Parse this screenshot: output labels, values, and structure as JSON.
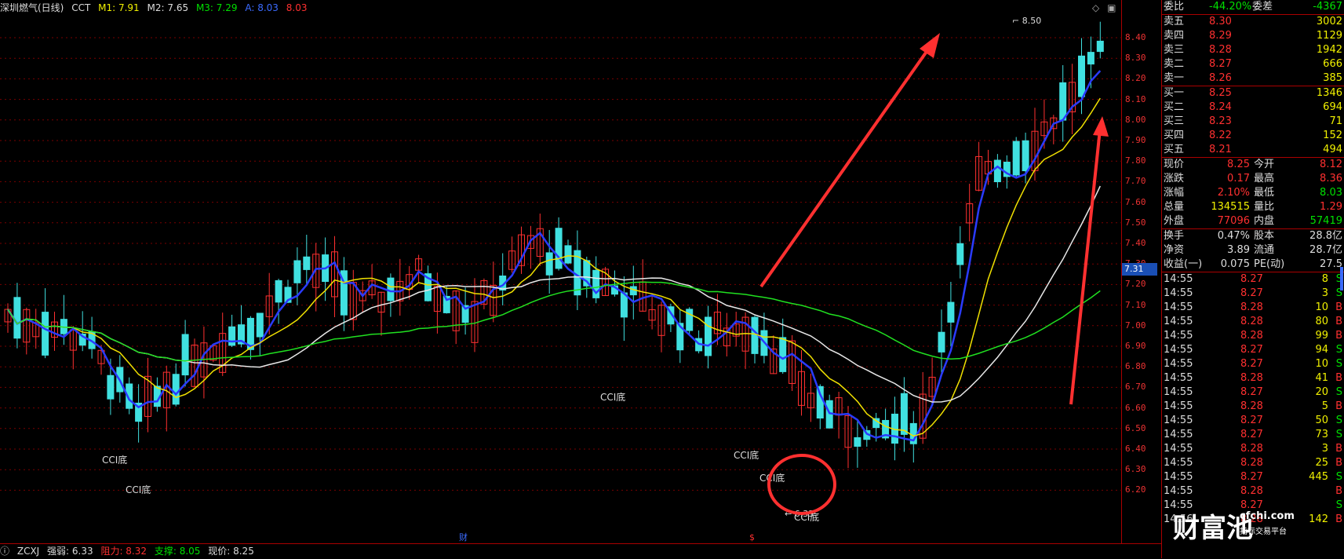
{
  "legend": {
    "stock": "深圳燃气(日线)",
    "indicator": "CCT",
    "m1": "M1: 7.91",
    "m2": "M2: 7.65",
    "m3": "M3: 7.29",
    "a": "A: 8.03",
    "b": "8.03"
  },
  "colors": {
    "up": "#ff3030",
    "down": "#40e0e0",
    "ma_blue": "#2a3bff",
    "ma_yellow": "#f0e000",
    "ma_white": "#e8e8e8",
    "ma_green": "#20e020",
    "axis": "#e33",
    "grid": "#7a0000"
  },
  "price_axis": [
    "8.40",
    "8.30",
    "8.20",
    "8.10",
    "8.00",
    "7.90",
    "7.80",
    "7.70",
    "7.60",
    "7.50",
    "7.40",
    "7.30",
    "7.20",
    "7.10",
    "7.00",
    "6.90",
    "6.80",
    "6.70",
    "6.60",
    "6.50",
    "6.40",
    "6.30",
    "6.20"
  ],
  "current_price_label": "7.31",
  "annotations": {
    "high": "8.50",
    "low": "6.33",
    "cci_labels": [
      "CCI底",
      "CCI底",
      "CCI底",
      "CCI底",
      "CCI底",
      "CCI底"
    ],
    "markers": [
      "财",
      "$"
    ]
  },
  "indicator_bar": {
    "name": "ZCXJ",
    "strength": "强弱: 6.33",
    "resistance": "阻力: 8.32",
    "support": "支撑: 8.05",
    "price": "现价: 8.25"
  },
  "panel": {
    "wei_bi_label": "委比",
    "wei_bi": "-44.20%",
    "wei_cha_label": "委差",
    "wei_cha": "-4367",
    "asks": [
      {
        "label": "卖五",
        "price": "8.30",
        "vol": "3002"
      },
      {
        "label": "卖四",
        "price": "8.29",
        "vol": "1129"
      },
      {
        "label": "卖三",
        "price": "8.28",
        "vol": "1942"
      },
      {
        "label": "卖二",
        "price": "8.27",
        "vol": "666"
      },
      {
        "label": "卖一",
        "price": "8.26",
        "vol": "385"
      }
    ],
    "bids": [
      {
        "label": "买一",
        "price": "8.25",
        "vol": "1346"
      },
      {
        "label": "买二",
        "price": "8.24",
        "vol": "694"
      },
      {
        "label": "买三",
        "price": "8.23",
        "vol": "71"
      },
      {
        "label": "买四",
        "price": "8.22",
        "vol": "152"
      },
      {
        "label": "买五",
        "price": "8.21",
        "vol": "494"
      }
    ],
    "stats": [
      {
        "l1": "现价",
        "v1": "8.25",
        "l2": "今开",
        "v2": "8.12"
      },
      {
        "l1": "涨跌",
        "v1": "0.17",
        "l2": "最高",
        "v2": "8.36"
      },
      {
        "l1": "涨幅",
        "v1": "2.10%",
        "l2": "最低",
        "v2": "8.03"
      },
      {
        "l1": "总量",
        "v1": "134515",
        "l2": "量比",
        "v2": "1.29"
      },
      {
        "l1": "外盘",
        "v1": "77096",
        "l2": "内盘",
        "v2": "57419"
      }
    ],
    "stats2": [
      {
        "l1": "换手",
        "v1": "0.47%",
        "l2": "股本",
        "v2": "28.8亿"
      },
      {
        "l1": "净资",
        "v1": "3.89",
        "l2": "流通",
        "v2": "28.7亿"
      },
      {
        "l1": "收益(一)",
        "v1": "0.075",
        "l2": "PE(动)",
        "v2": "27.5"
      }
    ],
    "ticks": [
      {
        "t": "14:55",
        "p": "8.27",
        "v": "8",
        "s": "S"
      },
      {
        "t": "14:55",
        "p": "8.27",
        "v": "3",
        "s": "S"
      },
      {
        "t": "14:55",
        "p": "8.28",
        "v": "10",
        "s": "B"
      },
      {
        "t": "14:55",
        "p": "8.28",
        "v": "80",
        "s": "B"
      },
      {
        "t": "14:55",
        "p": "8.28",
        "v": "99",
        "s": "B"
      },
      {
        "t": "14:55",
        "p": "8.27",
        "v": "94",
        "s": "S"
      },
      {
        "t": "14:55",
        "p": "8.27",
        "v": "10",
        "s": "S"
      },
      {
        "t": "14:55",
        "p": "8.28",
        "v": "41",
        "s": "B"
      },
      {
        "t": "14:55",
        "p": "8.27",
        "v": "20",
        "s": "S"
      },
      {
        "t": "14:55",
        "p": "8.28",
        "v": "5",
        "s": "B"
      },
      {
        "t": "14:55",
        "p": "8.27",
        "v": "50",
        "s": "S"
      },
      {
        "t": "14:55",
        "p": "8.27",
        "v": "73",
        "s": "S"
      },
      {
        "t": "14:55",
        "p": "8.28",
        "v": "3",
        "s": "B"
      },
      {
        "t": "14:55",
        "p": "8.28",
        "v": "25",
        "s": "B"
      },
      {
        "t": "14:55",
        "p": "8.27",
        "v": "445",
        "s": "S"
      },
      {
        "t": "14:55",
        "p": "8.28",
        "v": "",
        "s": "B"
      },
      {
        "t": "14:55",
        "p": "8.27",
        "v": "",
        "s": "S"
      },
      {
        "t": "14:56",
        "p": "8.28",
        "v": "142",
        "s": "B"
      }
    ]
  },
  "watermark": {
    "brand": "财富池",
    "url": "cfchi.com",
    "sub": "指标交易平台"
  }
}
